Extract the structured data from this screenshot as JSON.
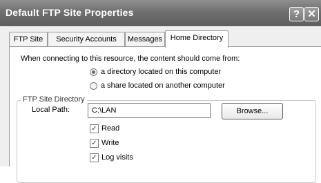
{
  "window": {
    "title": "Default FTP Site Properties",
    "help_glyph": "?",
    "close_glyph": "✕"
  },
  "tabs": [
    {
      "label": "FTP Site"
    },
    {
      "label": "Security Accounts"
    },
    {
      "label": "Messages"
    },
    {
      "label": "Home Directory",
      "active": true
    }
  ],
  "content": {
    "intro": "When connecting to this resource, the content should come from:",
    "radio_options": [
      {
        "label": "a directory located on this computer",
        "selected": true
      },
      {
        "label": "a share located on another computer",
        "selected": false
      }
    ],
    "group_label": "FTP Site Directory",
    "local_path_label": "Local Path:",
    "local_path_value": "C:\\LAN",
    "browse_label": "Browse...",
    "checkboxes": [
      {
        "label": "Read",
        "checked": true
      },
      {
        "label": "Write",
        "checked": true
      },
      {
        "label": "Log visits",
        "checked": true
      }
    ]
  }
}
